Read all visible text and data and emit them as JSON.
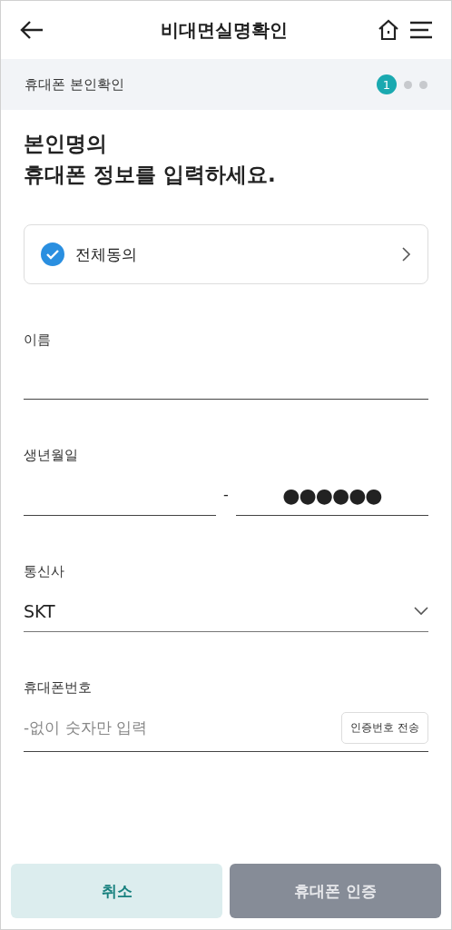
{
  "header": {
    "title": "비대면실명확인"
  },
  "step_bar": {
    "label": "휴대폰 본인확인",
    "steps": [
      {
        "label": "1",
        "selected": true
      },
      {
        "selected": false
      },
      {
        "selected": false
      }
    ]
  },
  "heading": [
    "본인명의",
    "휴대폰 정보를 입력하세요."
  ],
  "agree_all": {
    "label": "전체동의",
    "checked": true
  },
  "name_field": {
    "label": "이름"
  },
  "birth_field": {
    "label": "생년월일",
    "separator": "-",
    "masked_value": "●●●●●●"
  },
  "carrier_field": {
    "label": "통신사",
    "value": "SKT"
  },
  "phone_field": {
    "label": "휴대폰번호",
    "placeholder": "-없이 숫자만 입력",
    "send_button": "인증번호 전송"
  },
  "buttons": [
    {
      "label": "취소",
      "kind": "secondary",
      "disabled": false
    },
    {
      "label": "휴대폰 인증",
      "kind": "primary",
      "disabled": true
    }
  ]
}
